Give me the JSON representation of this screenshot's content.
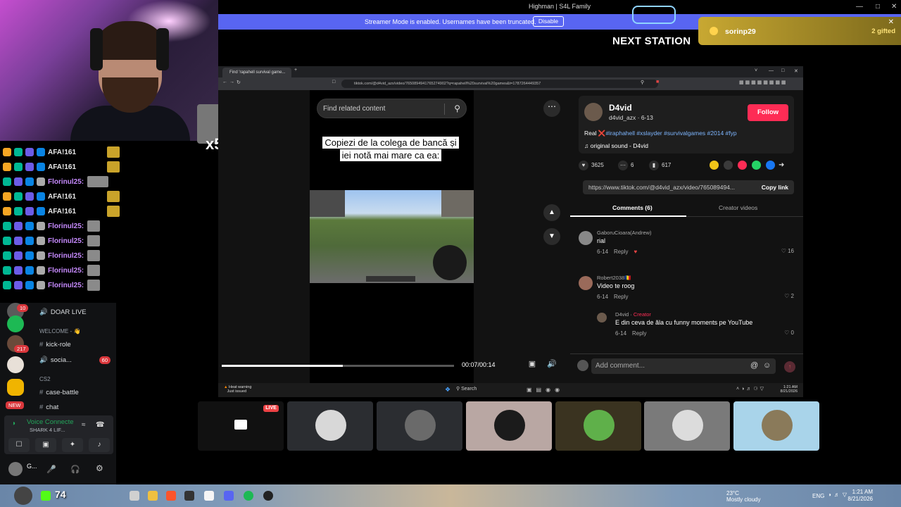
{
  "window": {
    "title": "Highman | S4L Family"
  },
  "streamer_banner": {
    "message": "Streamer Mode is enabled. Usernames have been truncated.",
    "button": "Disable"
  },
  "overlay": {
    "next_station": "NEXT STATION",
    "gift": {
      "user": "sorinp29",
      "count": "2 gifted"
    },
    "emote_multiplier": "x5",
    "kick_viewers": "74"
  },
  "chat_lines": [
    {
      "name": "AFA!️161",
      "color": "#e8e8e8"
    },
    {
      "name": "AFA!️161",
      "color": "#e8e8e8"
    },
    {
      "name": "Florinul25:",
      "color": "#c78bff"
    },
    {
      "name": "AFA!️161",
      "color": "#e8e8e8"
    },
    {
      "name": "AFA!️161",
      "color": "#e8e8e8"
    },
    {
      "name": "Florinul25:",
      "color": "#c78bff"
    },
    {
      "name": "Florinul25:",
      "color": "#c78bff"
    },
    {
      "name": "Florinul25:",
      "color": "#c78bff"
    },
    {
      "name": "Florinul25:",
      "color": "#c78bff"
    },
    {
      "name": "Florinul25:",
      "color": "#c78bff"
    }
  ],
  "discord": {
    "channels": {
      "doar_live": "DOAR LIVE",
      "welcome_cat": "WELCOME - 👋",
      "kick_role": "kick-role",
      "social": "socia...",
      "social_badge": "60",
      "cs2_cat": "CS2",
      "case_battle": "case-battle",
      "chat": "chat"
    },
    "server_badges": {
      "b1": "10",
      "b2": "217"
    },
    "new_badge": "NEW",
    "voice": {
      "title": "Voice Connecte",
      "sub": "SHARK 4 LIF..."
    },
    "user": {
      "name": "G..."
    }
  },
  "browser": {
    "tab_title": "Find 'rapahell survival game...",
    "url": "tiktok.com/@d4vid_azx/video/7650894941765274902?q=rapahell%20survival%20games&t=1787264449357"
  },
  "tiktok": {
    "search_placeholder": "Find related content",
    "caption": "Copiezi de la colega de bancă și iei notă mai mare ca ea:",
    "time": "00:07/00:14",
    "progress": 0.52,
    "author": {
      "display": "D4vid",
      "handle": "d4vid_azx · 6-13",
      "follow": "Follow"
    },
    "description": {
      "prefix": "Real ",
      "tags": "#iraphahell #xslayder #survivalgames #2014 #fyp"
    },
    "sound": "original sound - D4vid",
    "stats": {
      "likes": "3625",
      "comments": "6",
      "saves": "617"
    },
    "link": {
      "url": "https://www.tiktok.com/@d4vid_azx/video/765089494...",
      "copy": "Copy link"
    },
    "tabs": {
      "comments": "Comments (6)",
      "creator": "Creator videos"
    },
    "comments": [
      {
        "user": "GaboruCioara(Andrew)",
        "text": "rial",
        "date": "6-14",
        "reply": "Reply",
        "likes": "16"
      },
      {
        "user": "Robert2038🇷🇴",
        "text": "Video te roog",
        "date": "6-14",
        "reply": "Reply",
        "likes": "2"
      },
      {
        "user": "D4vid",
        "tag": "Creator",
        "text": "E din ceva de ăla cu funny moments pe YouTube",
        "date": "6-14",
        "reply": "Reply",
        "likes": "0"
      }
    ],
    "add_comment": "Add comment..."
  },
  "inner_taskbar": {
    "heat": "Heat warning",
    "heat_sub": "Just issued",
    "search": "Search",
    "time": "1:21 AM",
    "date": "8/21/2026"
  },
  "participants_live": "LIVE",
  "taskbar": {
    "weather": "23°C",
    "weather_sub": "Mostly cloudy",
    "lang": "ENG",
    "time": "1:21 AM",
    "date": "8/21/2026"
  }
}
